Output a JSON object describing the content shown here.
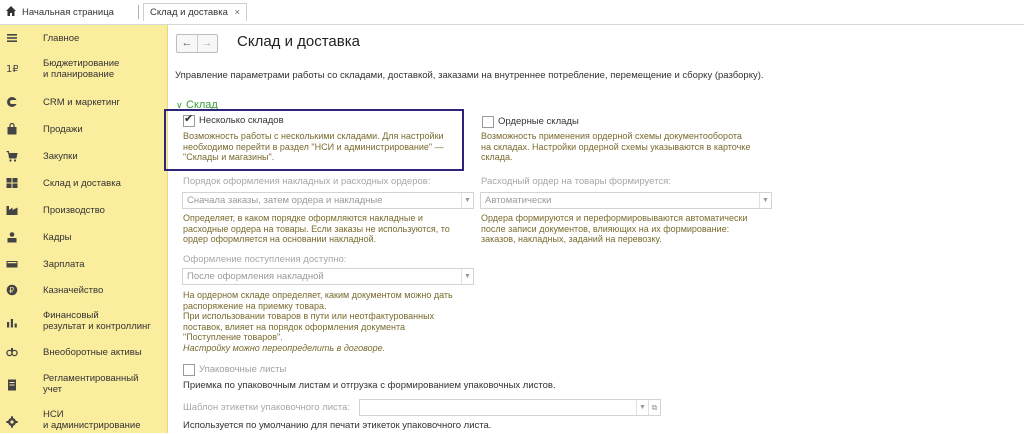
{
  "tabs": {
    "home_label": "Начальная страница",
    "active_label": "Склад и доставка",
    "close_glyph": "×"
  },
  "sidebar": {
    "items": [
      {
        "label": "Главное",
        "icon": "menu-icon"
      },
      {
        "label": "Бюджетирование\nи планирование",
        "icon": "budget-icon"
      },
      {
        "label": "CRM и маркетинг",
        "icon": "crm-icon"
      },
      {
        "label": "Продажи",
        "icon": "bag-icon"
      },
      {
        "label": "Закупки",
        "icon": "cart-icon"
      },
      {
        "label": "Склад и доставка",
        "icon": "warehouse-icon"
      },
      {
        "label": "Производство",
        "icon": "factory-icon"
      },
      {
        "label": "Кадры",
        "icon": "person-icon"
      },
      {
        "label": "Зарплата",
        "icon": "money-icon"
      },
      {
        "label": "Казначейство",
        "icon": "treasury-icon"
      },
      {
        "label": "Финансовый\nрезультат и контроллинг",
        "icon": "chart-icon"
      },
      {
        "label": "Внеоборотные активы",
        "icon": "assets-icon"
      },
      {
        "label": "Регламентированный\nучет",
        "icon": "document-icon"
      },
      {
        "label": "НСИ\nи администрирование",
        "icon": "gear-icon"
      }
    ]
  },
  "main": {
    "back_glyph": "←",
    "forward_glyph": "→",
    "title": "Склад и доставка",
    "description": "Управление параметрами работы со складами, доставкой, заказами на внутреннее потребление, перемещение и сборку (разборку).",
    "group_title": "Склад",
    "group_chevron": "∨",
    "multi_wh": {
      "label": "Несколько складов",
      "checked": true,
      "hint": "Возможность работы с несколькими складами. Для настройки\nнеобходимо перейти в раздел \"НСИ и администрирование\" —\n\"Склады и магазины\"."
    },
    "order_wh": {
      "label": "Ордерные склады",
      "checked": false,
      "hint": "Возможность применения ордерной схемы документооборота\nна складах. Настройки ордерной схемы указываются в карточке\nсклада."
    },
    "order_proc": {
      "label": "Порядок оформления накладных и расходных ордеров:",
      "value": "Сначала заказы, затем ордера и накладные",
      "hint": "Определяет, в каком порядке оформляются накладные и\nрасходные ордера на товары. Если заказы не используются, то\nордер оформляется на основании накладной."
    },
    "outgoing_order": {
      "label": "Расходный ордер на товары формируется:",
      "value": "Автоматически",
      "hint": "Ордера формируются и переформировываются автоматически\nпосле записи документов, влияющих на их формирование:\nзаказов, накладных, заданий на перевозку."
    },
    "receipt": {
      "label": "Оформление поступления доступно:",
      "value": "После оформления накладной",
      "hint": "На ордерном складе определяет, каким документом можно дать\nраспоряжение на приемку товара.\nПри использовании товаров в пути или неотфактурованных\nпоставок, влияет на порядок оформления документа\n\"Поступление товаров\".",
      "hint_italic": "Настройку можно переопределить в договоре."
    },
    "packing": {
      "label": "Упаковочные листы",
      "checked": false,
      "hint": "Приемка по упаковочным листам и отгрузка с формированием упаковочных листов."
    },
    "label_template": {
      "label": "Шаблон этикетки упаковочного листа:",
      "value": "",
      "hint": "Используется по умолчанию для печати этикеток упаковочного листа."
    },
    "select_arrow_glyph": "▼",
    "link_glyph": "⧉"
  },
  "colors": {
    "sidebar_bg": "#fbed9e",
    "group_title": "#3a9c3a",
    "highlight_border": "#2d2378",
    "hint_text": "#7a6a2e"
  }
}
